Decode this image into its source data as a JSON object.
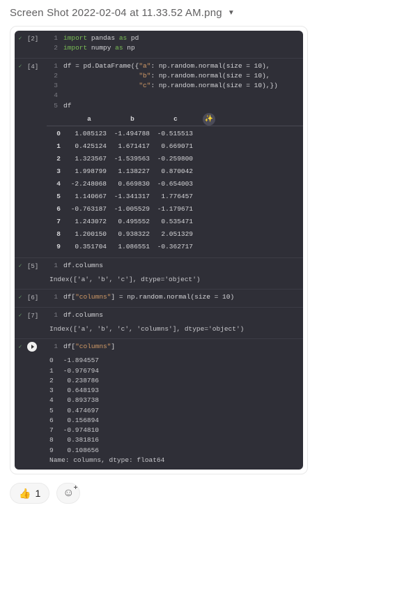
{
  "title": "Screen Shot 2022-02-04 at 11.33.52 AM.png",
  "cells": [
    {
      "exec": "[2]",
      "lines": [
        {
          "n": "1",
          "html": "<span class='kw'>import</span> pandas <span class='kw'>as</span> pd"
        },
        {
          "n": "2",
          "html": "<span class='kw'>import</span> numpy <span class='kw'>as</span> np"
        }
      ]
    },
    {
      "exec": "[4]",
      "lines": [
        {
          "n": "1",
          "html": "df = pd.DataFrame({<span class='str'>\"a\"</span>: np.random.normal(size = 10),"
        },
        {
          "n": "2",
          "html": "                   <span class='str'>\"b\"</span>: np.random.normal(size = 10),"
        },
        {
          "n": "3",
          "html": "                   <span class='str'>\"c\"</span>: np.random.normal(size = 10),})"
        },
        {
          "n": "4",
          "html": ""
        },
        {
          "n": "5",
          "html": "df"
        }
      ],
      "dataframe": {
        "columns": [
          "a",
          "b",
          "c"
        ],
        "rows": [
          {
            "idx": "0",
            "vals": [
              "1.085123",
              "-1.494788",
              "-0.515513"
            ]
          },
          {
            "idx": "1",
            "vals": [
              "0.425124",
              "1.671417",
              "0.669071"
            ]
          },
          {
            "idx": "2",
            "vals": [
              "1.323567",
              "-1.539563",
              "-0.259800"
            ]
          },
          {
            "idx": "3",
            "vals": [
              "1.998799",
              "1.138227",
              "0.870042"
            ]
          },
          {
            "idx": "4",
            "vals": [
              "-2.248068",
              "0.669830",
              "-0.654003"
            ]
          },
          {
            "idx": "5",
            "vals": [
              "1.140667",
              "-1.341317",
              "1.776457"
            ]
          },
          {
            "idx": "6",
            "vals": [
              "-0.763187",
              "-1.005529",
              "-1.179671"
            ]
          },
          {
            "idx": "7",
            "vals": [
              "1.243072",
              "0.495552",
              "0.535471"
            ]
          },
          {
            "idx": "8",
            "vals": [
              "1.200150",
              "0.938322",
              "2.051329"
            ]
          },
          {
            "idx": "9",
            "vals": [
              "0.351704",
              "1.086551",
              "-0.362717"
            ]
          }
        ]
      }
    },
    {
      "exec": "[5]",
      "lines": [
        {
          "n": "1",
          "html": "df.columns"
        }
      ],
      "output_text": "Index(['a', 'b', 'c'], dtype='object')"
    },
    {
      "exec": "[6]",
      "lines": [
        {
          "n": "1",
          "html": "df[<span class='str'>\"columns\"</span>] = np.random.normal(size = 10)"
        }
      ]
    },
    {
      "exec": "[7]",
      "lines": [
        {
          "n": "1",
          "html": "df.columns"
        }
      ],
      "output_text": "Index(['a', 'b', 'c', 'columns'], dtype='object')"
    },
    {
      "play": true,
      "lines": [
        {
          "n": "1",
          "html": "df[<span class='str'>\"columns\"</span>]"
        }
      ],
      "series": {
        "rows": [
          {
            "idx": "0",
            "val": "-1.894557"
          },
          {
            "idx": "1",
            "val": "-0.976794"
          },
          {
            "idx": "2",
            "val": " 0.238786"
          },
          {
            "idx": "3",
            "val": " 0.648193"
          },
          {
            "idx": "4",
            "val": " 0.893738"
          },
          {
            "idx": "5",
            "val": " 0.474697"
          },
          {
            "idx": "6",
            "val": " 0.156894"
          },
          {
            "idx": "7",
            "val": "-0.974810"
          },
          {
            "idx": "8",
            "val": " 0.381816"
          },
          {
            "idx": "9",
            "val": " 0.108656"
          }
        ],
        "footer": "Name: columns, dtype: float64"
      }
    }
  ],
  "reactions": {
    "thumbs": {
      "emoji": "👍",
      "count": "1"
    }
  }
}
